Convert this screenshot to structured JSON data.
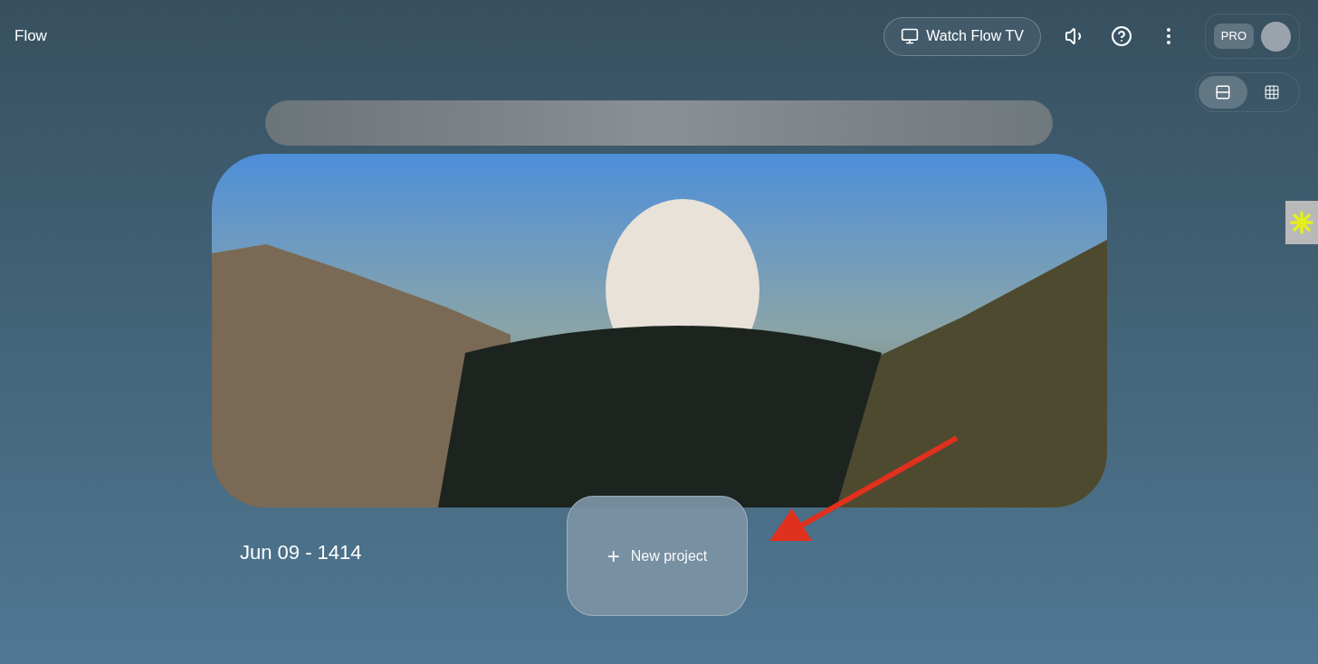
{
  "header": {
    "title": "Flow",
    "watch_button": "Watch Flow TV",
    "plan_badge": "PRO"
  },
  "view_toggle": [
    {
      "kind": "list",
      "selected": true
    },
    {
      "kind": "grid",
      "selected": false
    }
  ],
  "project": {
    "date": "Jun 09 - 1414"
  },
  "new_project": {
    "icon": "+",
    "label": "New project"
  }
}
